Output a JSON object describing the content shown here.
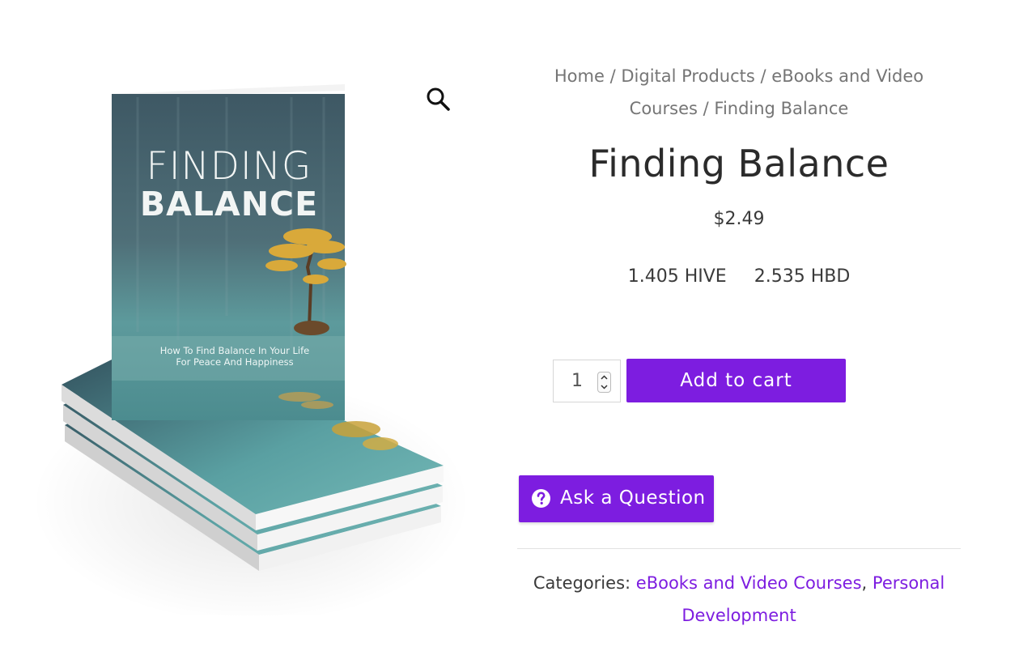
{
  "gallery": {
    "cover_title_line1": "FINDING",
    "cover_title_line2": "BALANCE",
    "cover_subtitle_line1": "How To Find Balance In Your Life",
    "cover_subtitle_line2": "For Peace And Happiness",
    "zoom_icon": "magnifier-icon"
  },
  "breadcrumb": {
    "items": [
      "Home",
      "Digital Products",
      "eBooks and Video Courses",
      "Finding Balance"
    ],
    "separator": "/"
  },
  "product": {
    "title": "Finding Balance",
    "price": "$2.49",
    "crypto": [
      {
        "amount": "1.405",
        "unit": "HIVE"
      },
      {
        "amount": "2.535",
        "unit": "HBD"
      }
    ]
  },
  "cart": {
    "quantity": "1",
    "add_label": "Add to cart"
  },
  "ask": {
    "label": "Ask a Question",
    "icon": "question-circle-icon"
  },
  "meta": {
    "categories_label": "Categories:",
    "categories": [
      "eBooks and Video Courses",
      "Personal Development"
    ]
  },
  "colors": {
    "accent": "#7d1de0",
    "text": "#3a3a3a",
    "muted": "#757575"
  }
}
